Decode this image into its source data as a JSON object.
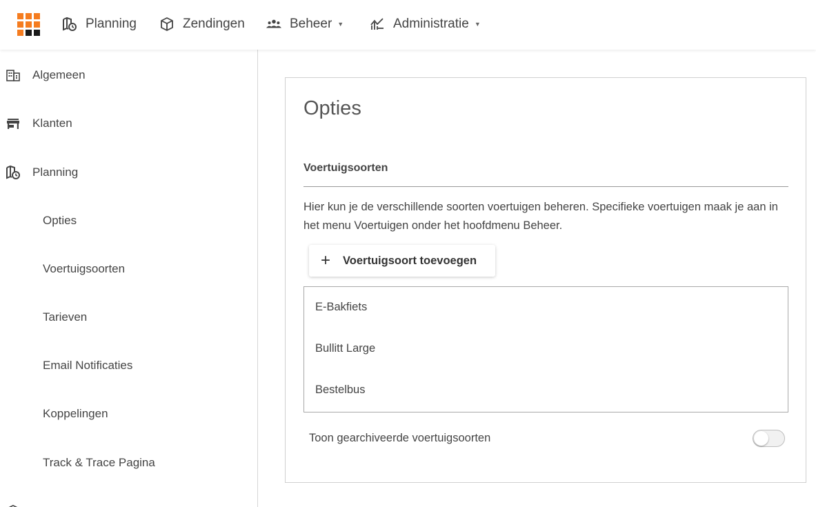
{
  "colors": {
    "brand_orange": "#f57c1f",
    "brand_dark": "#1a1a1a",
    "text": "#444444",
    "border": "#cfcfcf"
  },
  "logo": {
    "cells": [
      "#f57c1f",
      "#f57c1f",
      "#f57c1f",
      "#f57c1f",
      "#f57c1f",
      "#f57c1f",
      "#f57c1f",
      "#1a1a1a",
      "#1a1a1a"
    ]
  },
  "topnav": {
    "items": [
      {
        "label": "Planning",
        "icon": "map-clock-icon",
        "dropdown": false
      },
      {
        "label": "Zendingen",
        "icon": "package-icon",
        "dropdown": false
      },
      {
        "label": "Beheer",
        "icon": "users-icon",
        "dropdown": true
      },
      {
        "label": "Administratie",
        "icon": "chart-icon",
        "dropdown": true
      }
    ]
  },
  "sidebar": {
    "items": [
      {
        "label": "Algemeen",
        "icon": "building-icon"
      },
      {
        "label": "Klanten",
        "icon": "store-icon"
      },
      {
        "label": "Planning",
        "icon": "map-clock-icon"
      },
      {
        "label": "Opties"
      },
      {
        "label": "Voertuigsoorten"
      },
      {
        "label": "Tarieven"
      },
      {
        "label": "Email Notificaties"
      },
      {
        "label": "Koppelingen"
      },
      {
        "label": "Track & Trace Pagina"
      }
    ]
  },
  "main": {
    "title": "Opties",
    "section": {
      "heading": "Voertuigsoorten",
      "description": "Hier kun je de verschillende soorten voertuigen beheren. Specifieke voertuigen maak je aan in het menu Voertuigen onder het hoofdmenu Beheer.",
      "add_button_label": "Voertuigsoort toevoegen",
      "add_button_icon": "+",
      "vehicle_types": [
        "E-Bakfiets",
        "Bullitt Large",
        "Bestelbus"
      ],
      "toggle_label": "Toon gearchiveerde voertuigsoorten",
      "toggle_on": false
    }
  }
}
